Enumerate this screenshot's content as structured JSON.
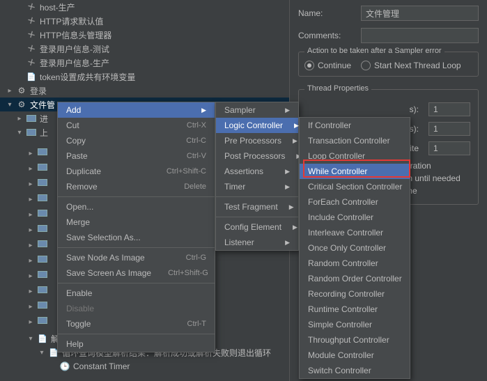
{
  "tree": {
    "n0": "host-生产",
    "n1": "HTTP请求默认值",
    "n2": "HTTP信息头管理器",
    "n3": "登录用户信息-测试",
    "n4": "登录用户信息-生产",
    "n5": "token设置成共有环境变量",
    "n6": "登录",
    "n7": "文件管",
    "n8": "进",
    "n9": "上",
    "n10": "解析中文件进入轮洵调用，查询处理结果",
    "n11": "循环查询模型解析结果：解析成功或解析失败则退出循环",
    "n12": "Constant Timer"
  },
  "right": {
    "nameLabel": "Name:",
    "nameValue": "文件管理",
    "commentsLabel": "Comments:",
    "actionLegend": "Action to be taken after a Sampler error",
    "optContinue": "Continue",
    "optStartNext": "Start Next Thread Loop",
    "threadLegend": "Thread Properties",
    "threadsLabel": "s):",
    "threadsVal": "1",
    "secondsLabel": "ds):",
    "secondsVal": "1",
    "loopLabel": "nite",
    "loopVal": "1",
    "chkIteration": "iteration",
    "chkUntil": "ion until needed",
    "chkTime": "time"
  },
  "menu1": [
    {
      "label": "Add",
      "sub": true,
      "hl": true
    },
    {
      "label": "Cut",
      "sc": "Ctrl-X"
    },
    {
      "label": "Copy",
      "sc": "Ctrl-C"
    },
    {
      "label": "Paste",
      "sc": "Ctrl-V"
    },
    {
      "label": "Duplicate",
      "sc": "Ctrl+Shift-C"
    },
    {
      "label": "Remove",
      "sc": "Delete"
    },
    {
      "sep": true
    },
    {
      "label": "Open..."
    },
    {
      "label": "Merge"
    },
    {
      "label": "Save Selection As..."
    },
    {
      "sep": true
    },
    {
      "label": "Save Node As Image",
      "sc": "Ctrl-G"
    },
    {
      "label": "Save Screen As Image",
      "sc": "Ctrl+Shift-G"
    },
    {
      "sep": true
    },
    {
      "label": "Enable"
    },
    {
      "label": "Disable",
      "disabled": true
    },
    {
      "label": "Toggle",
      "sc": "Ctrl-T"
    },
    {
      "sep": true
    },
    {
      "label": "Help"
    }
  ],
  "menu2": [
    {
      "label": "Sampler",
      "sub": true
    },
    {
      "label": "Logic Controller",
      "sub": true,
      "hl": true
    },
    {
      "label": "Pre Processors",
      "sub": true
    },
    {
      "label": "Post Processors",
      "sub": true
    },
    {
      "label": "Assertions",
      "sub": true
    },
    {
      "label": "Timer",
      "sub": true
    },
    {
      "sep": true
    },
    {
      "label": "Test Fragment",
      "sub": true
    },
    {
      "sep": true
    },
    {
      "label": "Config Element",
      "sub": true
    },
    {
      "label": "Listener",
      "sub": true
    }
  ],
  "menu3": [
    {
      "label": "If Controller"
    },
    {
      "label": "Transaction Controller"
    },
    {
      "label": "Loop Controller"
    },
    {
      "label": "While Controller",
      "hl": true
    },
    {
      "label": "Critical Section Controller"
    },
    {
      "label": "ForEach Controller"
    },
    {
      "label": "Include Controller"
    },
    {
      "label": "Interleave Controller"
    },
    {
      "label": "Once Only Controller"
    },
    {
      "label": "Random Controller"
    },
    {
      "label": "Random Order Controller"
    },
    {
      "label": "Recording Controller"
    },
    {
      "label": "Runtime Controller"
    },
    {
      "label": "Simple Controller"
    },
    {
      "label": "Throughput Controller"
    },
    {
      "label": "Module Controller"
    },
    {
      "label": "Switch Controller"
    }
  ]
}
